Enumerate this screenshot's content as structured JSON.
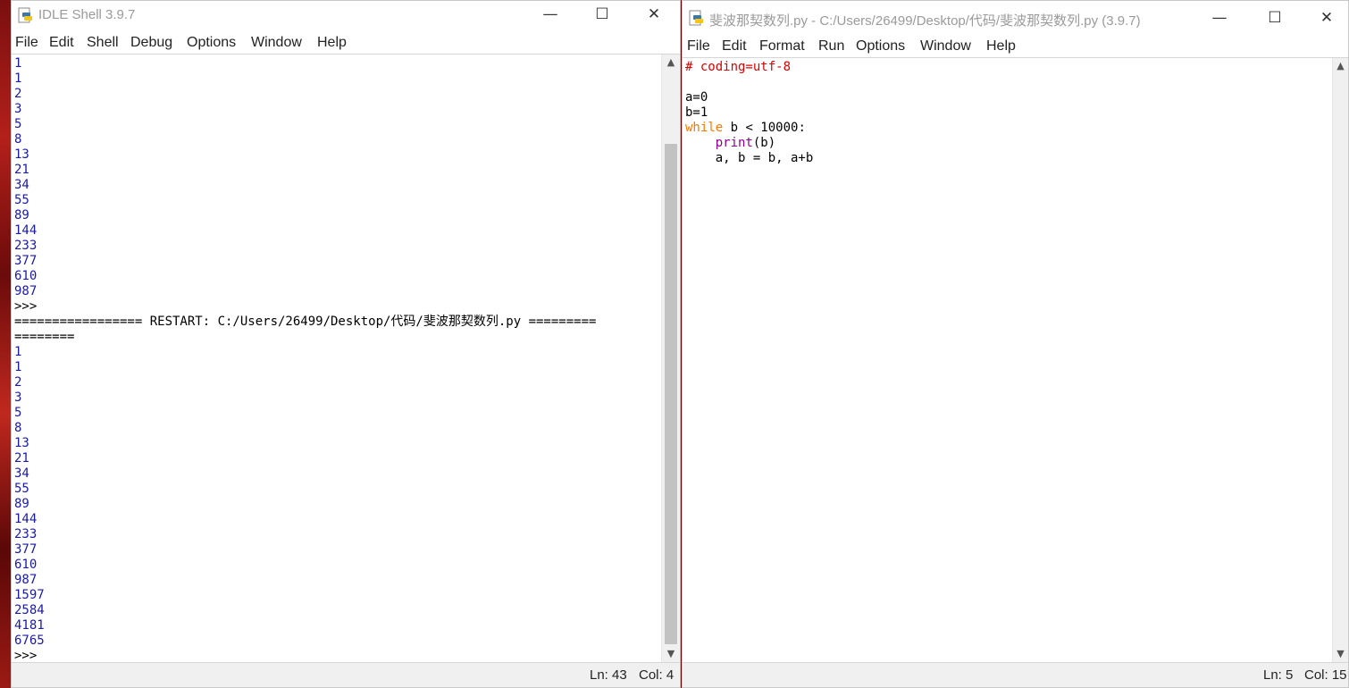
{
  "shell": {
    "title": "IDLE Shell 3.9.7",
    "menu": [
      "File",
      "Edit",
      "Shell",
      "Debug",
      "Options",
      "Window",
      "Help"
    ],
    "lines": [
      {
        "t": "1",
        "c": "out"
      },
      {
        "t": "1",
        "c": "out"
      },
      {
        "t": "2",
        "c": "out"
      },
      {
        "t": "3",
        "c": "out"
      },
      {
        "t": "5",
        "c": "out"
      },
      {
        "t": "8",
        "c": "out"
      },
      {
        "t": "13",
        "c": "out"
      },
      {
        "t": "21",
        "c": "out"
      },
      {
        "t": "34",
        "c": "out"
      },
      {
        "t": "55",
        "c": "out"
      },
      {
        "t": "89",
        "c": "out"
      },
      {
        "t": "144",
        "c": "out"
      },
      {
        "t": "233",
        "c": "out"
      },
      {
        "t": "377",
        "c": "out"
      },
      {
        "t": "610",
        "c": "out"
      },
      {
        "t": "987",
        "c": "out"
      },
      {
        "t": ">>>",
        "c": "plain"
      },
      {
        "t": "================= RESTART: C:/Users/26499/Desktop/代码/斐波那契数列.py =========",
        "c": "plain"
      },
      {
        "t": "========",
        "c": "plain"
      },
      {
        "t": "1",
        "c": "out"
      },
      {
        "t": "1",
        "c": "out"
      },
      {
        "t": "2",
        "c": "out"
      },
      {
        "t": "3",
        "c": "out"
      },
      {
        "t": "5",
        "c": "out"
      },
      {
        "t": "8",
        "c": "out"
      },
      {
        "t": "13",
        "c": "out"
      },
      {
        "t": "21",
        "c": "out"
      },
      {
        "t": "34",
        "c": "out"
      },
      {
        "t": "55",
        "c": "out"
      },
      {
        "t": "89",
        "c": "out"
      },
      {
        "t": "144",
        "c": "out"
      },
      {
        "t": "233",
        "c": "out"
      },
      {
        "t": "377",
        "c": "out"
      },
      {
        "t": "610",
        "c": "out"
      },
      {
        "t": "987",
        "c": "out"
      },
      {
        "t": "1597",
        "c": "out"
      },
      {
        "t": "2584",
        "c": "out"
      },
      {
        "t": "4181",
        "c": "out"
      },
      {
        "t": "6765",
        "c": "out"
      },
      {
        "t": ">>>",
        "c": "plain"
      }
    ],
    "status": {
      "ln": "Ln: 43",
      "col": "Col: 4"
    }
  },
  "editor": {
    "title": "斐波那契数列.py - C:/Users/26499/Desktop/代码/斐波那契数列.py (3.9.7)",
    "menu": [
      "File",
      "Edit",
      "Format",
      "Run",
      "Options",
      "Window",
      "Help"
    ],
    "lines": [
      [
        {
          "t": "# coding=utf-8",
          "c": "cm"
        }
      ],
      [
        {
          "t": "",
          "c": "plain"
        }
      ],
      [
        {
          "t": "a=0",
          "c": "plain"
        }
      ],
      [
        {
          "t": "b=1",
          "c": "plain"
        }
      ],
      [
        {
          "t": "while",
          "c": "kw"
        },
        {
          "t": " b < 10000:",
          "c": "plain"
        }
      ],
      [
        {
          "t": "    ",
          "c": "plain"
        },
        {
          "t": "print",
          "c": "bi"
        },
        {
          "t": "(b)",
          "c": "plain"
        }
      ],
      [
        {
          "t": "    a, b = b, a+b",
          "c": "plain"
        }
      ]
    ],
    "status": {
      "ln": "Ln: 5",
      "col": "Col: 15"
    }
  },
  "window_buttons": {
    "minimize": "—",
    "maximize": "☐",
    "close": "✕"
  }
}
